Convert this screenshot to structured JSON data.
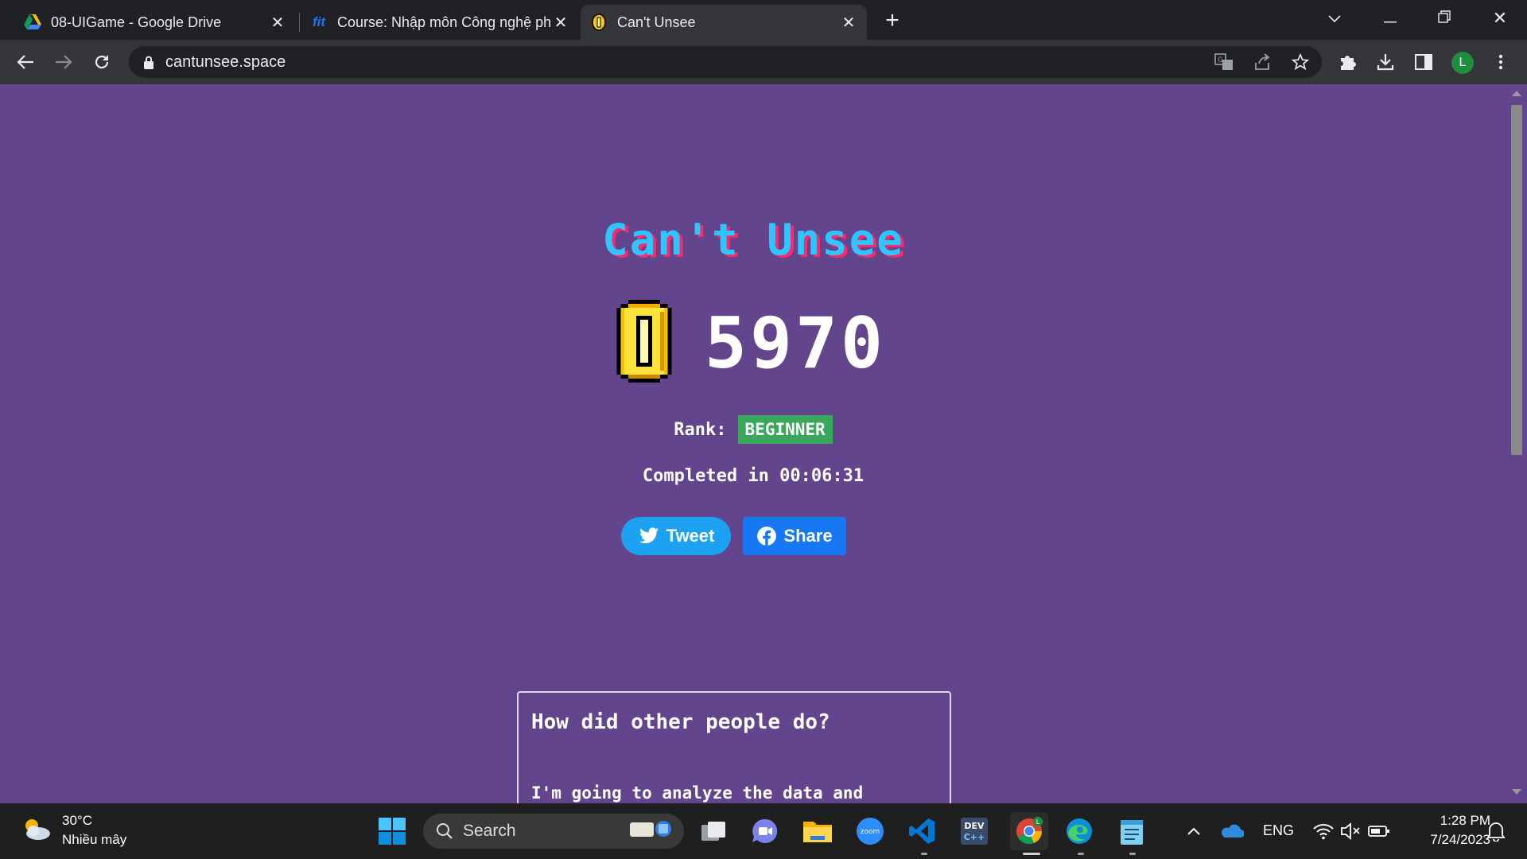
{
  "browser": {
    "tabs": [
      {
        "title": "08-UIGame - Google Drive",
        "icon": "google-drive-icon",
        "active": false
      },
      {
        "title": "Course: Nhập môn Công nghệ ph",
        "icon": "fit-icon",
        "active": false
      },
      {
        "title": "Can't Unsee",
        "icon": "coin-icon",
        "active": true
      }
    ],
    "url": "cantunsee.space",
    "profile_initial": "L"
  },
  "page": {
    "title": "Can't Unsee",
    "score": "5970",
    "rank_label": "Rank:",
    "rank_value": "BEGINNER",
    "completed": "Completed in 00:06:31",
    "tweet_label": "Tweet",
    "share_label": "Share",
    "stats_heading": "How did other people do?",
    "stats_text": "I'm going to analyze the data and",
    "colors": {
      "background": "#63458d",
      "title_cyan": "#2ec6ff",
      "title_pink": "#ff2a6d",
      "rank_badge": "#3aa85c",
      "tweet": "#1da1f2",
      "facebook": "#1877f2"
    }
  },
  "taskbar": {
    "weather_temp": "30°C",
    "weather_desc": "Nhiều mây",
    "search_placeholder": "Search",
    "language": "ENG",
    "time": "1:28 PM",
    "date": "7/24/2023",
    "apps": [
      "windows-start-icon",
      "task-view-icon",
      "teams-icon",
      "file-explorer-icon",
      "zoom-icon",
      "vscode-icon",
      "devc-icon",
      "chrome-icon",
      "edge-icon",
      "notepad-icon"
    ]
  }
}
